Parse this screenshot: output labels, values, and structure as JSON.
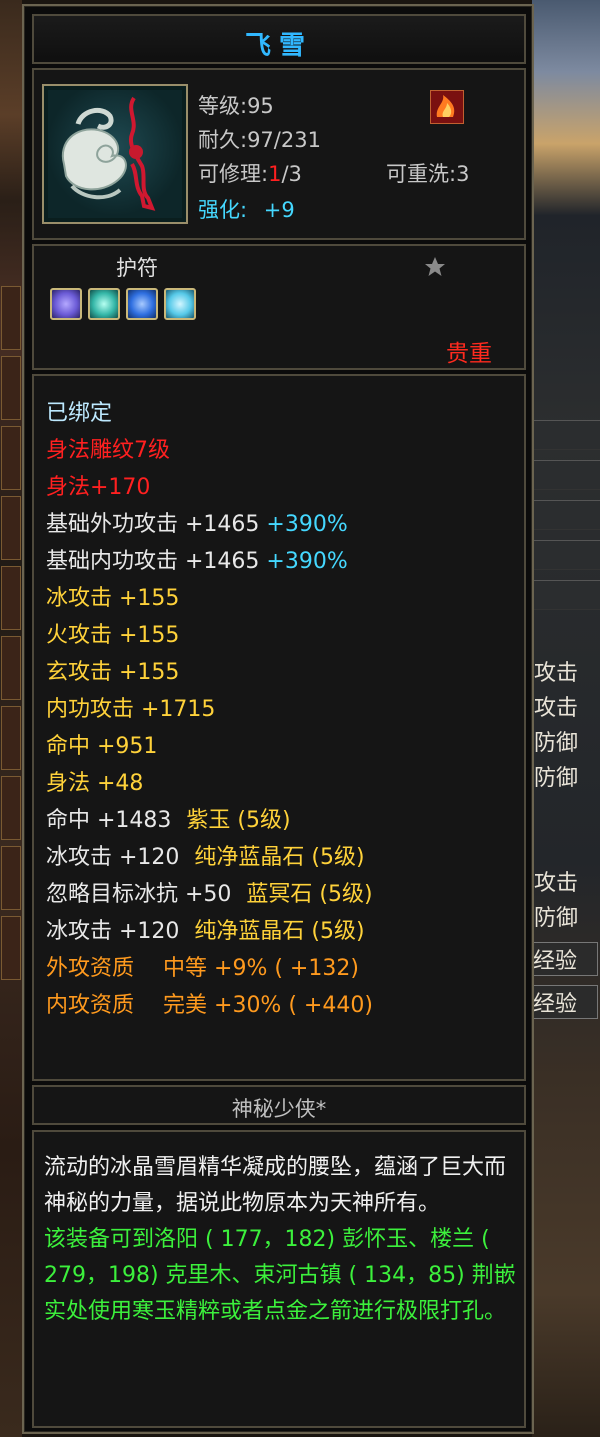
{
  "item": {
    "name": "飞雪",
    "level_text": "等级:95",
    "durability_text": "耐久:97/231",
    "repair_prefix": "可修理:",
    "repair_used": "1",
    "repair_total": "/3",
    "rewash_text": "可重洗:3",
    "enhance_label": "强化:",
    "enhance_value": "+9",
    "category": "护符",
    "rarity": "贵重",
    "maker": "神秘少侠*",
    "icon": "jade-pendant-icon",
    "corner_icon": "flame-badge-icon",
    "star_icon": "star-icon"
  },
  "gems": [
    {
      "icon": "purple-gem-icon",
      "color": "#6b5bd6"
    },
    {
      "icon": "teal-gem-icon",
      "color": "#35b7a8"
    },
    {
      "icon": "blue-gem-icon",
      "color": "#2f6fe0"
    },
    {
      "icon": "cyan-gem-icon",
      "color": "#56c9e8"
    }
  ],
  "attributes": {
    "bound": "已绑定",
    "carving": "身法雕纹7级",
    "carving_bonus": "身法+170",
    "base_outer_attack": "基础外功攻击 +1465",
    "base_outer_attack_pct": "+390%",
    "base_inner_attack": "基础内功攻击 +1465",
    "base_inner_attack_pct": "+390%",
    "ice_attack": "冰攻击 +155",
    "fire_attack": "火攻击 +155",
    "mystic_attack": "玄攻击 +155",
    "inner_attack": "内功攻击 +1715",
    "hit": "命中 +951",
    "agility": "身法 +48",
    "gem1_stat": "命中 +1483",
    "gem1_name": "紫玉 (5级)",
    "gem2_stat": "冰攻击 +120",
    "gem2_name": "纯净蓝晶石 (5级)",
    "gem3_stat": "忽略目标冰抗 +50",
    "gem3_name": "蓝冥石 (5级)",
    "gem4_stat": "冰攻击 +120",
    "gem4_name": "纯净蓝晶石 (5级)",
    "quality1_label": "外攻资质",
    "quality1_value": "中等 +9% ( +132)",
    "quality2_label": "内攻资质",
    "quality2_value": "完美 +30% ( +440)"
  },
  "description": {
    "lore": "流动的冰晶雪眉精华凝成的腰坠，蕴涵了巨大而神秘的力量，据说此物原本为天神所有。",
    "hint": "该装备可到洛阳 ( 177，182) 彭怀玉、楼兰 ( 279，198) 克里木、束河古镇 ( 134，85) 荆嵌实处使用寒玉精粹或者点金之箭进行极限打孔。"
  },
  "background_right": {
    "r1": "攻击",
    "r2": "攻击",
    "r3": "防御",
    "r4": "防御",
    "r5": "攻击",
    "r6": "防御",
    "r7": "经验",
    "r8": "经验"
  }
}
